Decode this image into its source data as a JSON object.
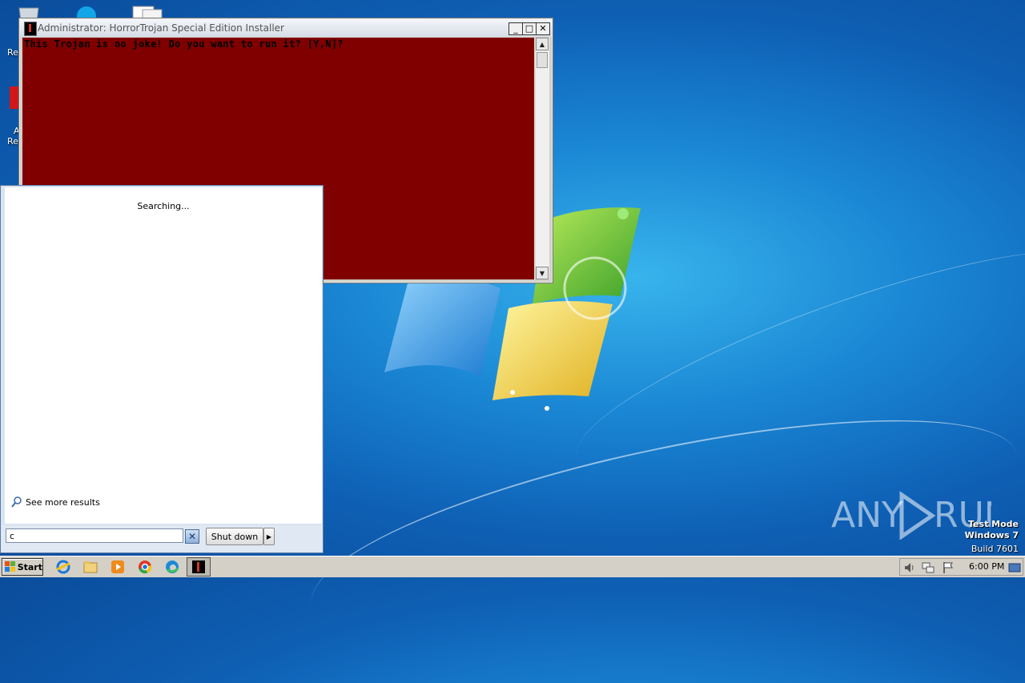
{
  "desktop": {
    "icon_labels": [
      "Re",
      "A",
      "Re"
    ]
  },
  "console": {
    "title": "Administrator:  HorrorTrojan Special Edition Installer",
    "text": "This Trojan is no joke! Do you want to run it? [Y,N]?",
    "buttons": {
      "minimize": "_",
      "maximize": "□",
      "close": "✕"
    },
    "background_color": "#800000"
  },
  "start_menu": {
    "status": "Searching...",
    "see_more": "See more results",
    "search_value": "c",
    "clear_label": "✕",
    "shutdown_label": "Shut down",
    "shutdown_arrow": "▶"
  },
  "taskbar": {
    "start_label": "Start",
    "pinned_icons": [
      "internet-explorer-icon",
      "explorer-icon",
      "media-player-icon",
      "chrome-icon",
      "edge-icon",
      "horrortrojan-icon"
    ],
    "clock": "6:00 PM"
  },
  "watermark": {
    "brand": "ANY RUN",
    "mode_line1": "Test Mode",
    "mode_line2": "Windows 7",
    "build": "Build 7601"
  }
}
